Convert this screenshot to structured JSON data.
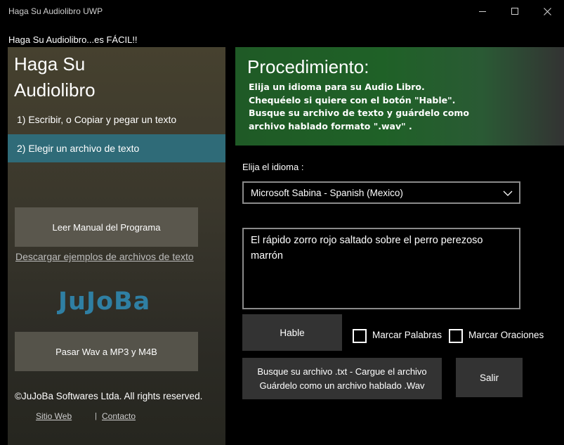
{
  "window": {
    "title": "Haga Su Audiolibro UWP",
    "controls": {
      "minimize": "minimize-icon",
      "maximize": "maximize-icon",
      "close": "close-icon"
    }
  },
  "header": {
    "subtitle": "Haga Su Audiolibro...es FÁCIL!!"
  },
  "sidebar": {
    "title_line1": "Haga Su",
    "title_line2": "Audiolibro",
    "items": [
      {
        "label": "1) Escribir, o Copiar y pegar un texto"
      },
      {
        "label": "2) Elegir un archivo de texto",
        "selected": true
      }
    ],
    "manual_button": "Leer Manual del Programa",
    "download_link": "Descargar ejemplos de archivos de texto",
    "logo_text": "JuJoBa",
    "wav_button": "Pasar Wav a MP3 y M4B",
    "copyright": "©JuJoBa Softwares Ltda. All rights reserved.",
    "footer": {
      "site_link": "Sitio Web",
      "separator": "|",
      "contact_link": "Contacto"
    },
    "accent_color": "#2f6b78"
  },
  "procedure": {
    "title": "Procedimiento:",
    "lines": [
      "Elija un idioma para su Audio Libro.",
      "Chequéelo si quiere con el botón \"Hable\".",
      "Busque su archivo de texto y guárdelo como",
      "archivo hablado formato \".wav\" ."
    ],
    "background_color": "#1f5a26"
  },
  "main": {
    "language_label": "Elija el idioma :",
    "language_selected": "Microsoft Sabina - Spanish (Mexico)",
    "text_value": "El rápido zorro rojo saltado sobre el perro perezoso marrón",
    "speak_button": "Hable",
    "mark_words_label": "Marcar Palabras",
    "mark_words_checked": false,
    "mark_sentences_label": "Marcar Oraciones",
    "mark_sentences_checked": false,
    "convert_button_line1": "Busque su archivo .txt - Cargue el archivo",
    "convert_button_line2": "Guárdelo como un archivo hablado .Wav",
    "exit_button": "Salir"
  }
}
